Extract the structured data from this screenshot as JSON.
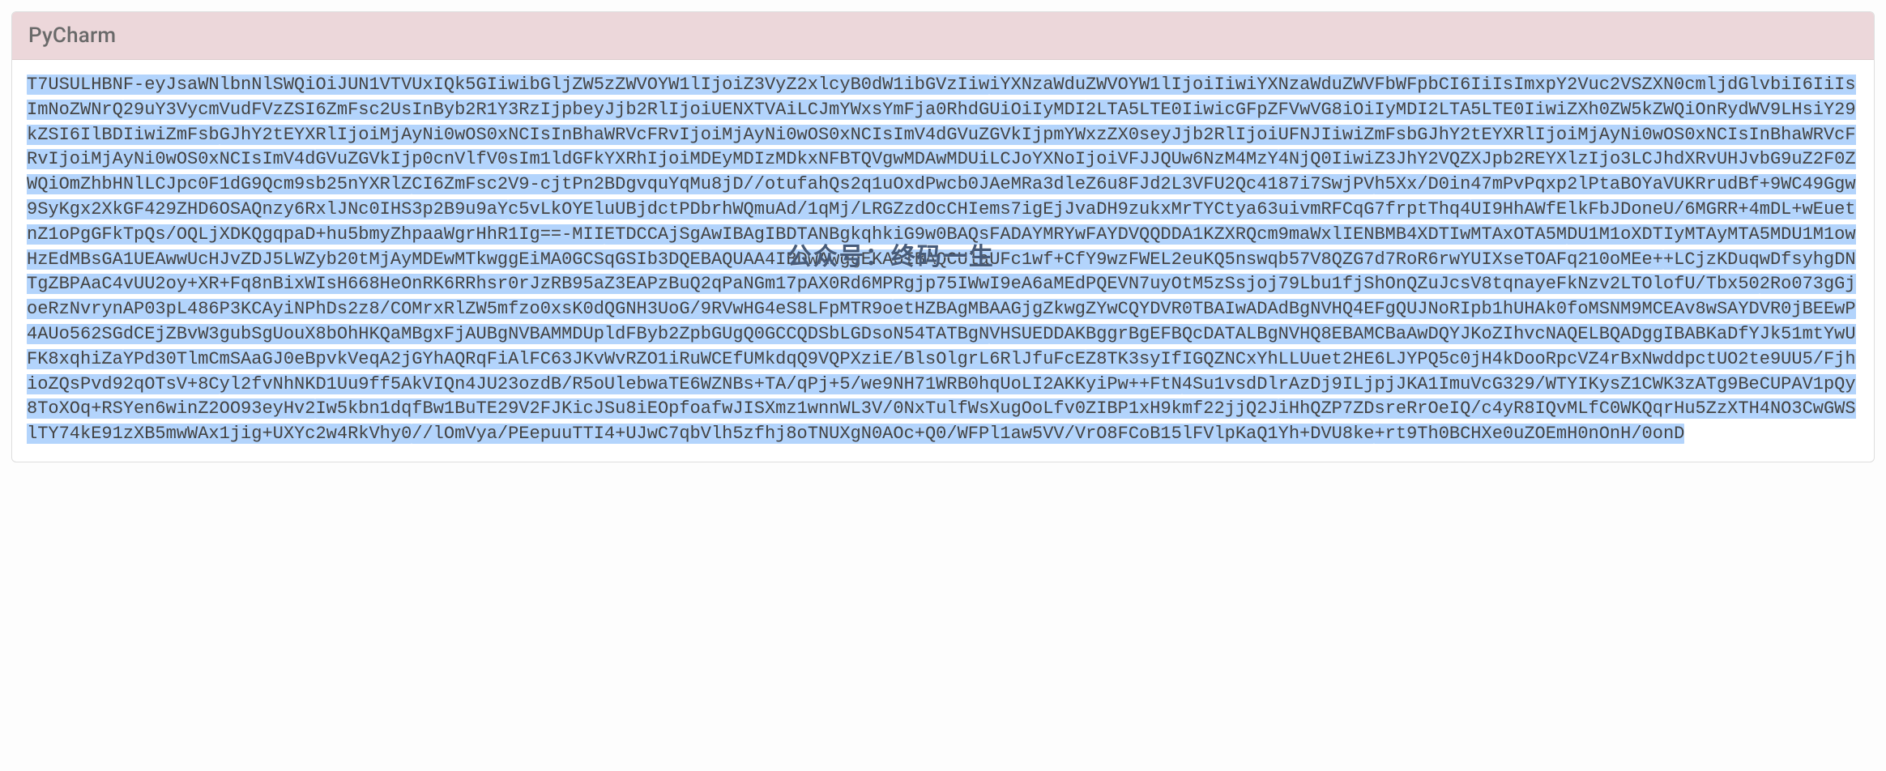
{
  "header": {
    "title": "PyCharm"
  },
  "license": {
    "code": "T7USULHBNF-eyJsaWNlbnNlSWQiOiJUN1VTVUxIQk5GIiwibGljZW5zZWVOYW1lIjoiZ3VyZ2xlcyB0dW1ibGVzIiwiYXNzaWduZWVOYW1lIjoiIiwiYXNzaWduZWVFbWFpbCI6IiIsImxpY2Vuc2VSZXN0cmljdGlvbiI6IiIsImNoZWNrQ29uY3VycmVudFVzZSI6ZmFsc2UsInByb2R1Y3RzIjpbeyJjb2RlIjoiUENXTVAiLCJmYWxsYmFja0RhdGUiOiIyMDI2LTA5LTE0IiwicGFpZFVwVG8iOiIyMDI2LTA5LTE0IiwiZXh0ZW5kZWQiOnRydWV9LHsiY29kZSI6IlBDIiwiZmFsbGJhY2tEYXRlIjoiMjAyNi0wOS0xNCIsInBhaWRVcFRvIjoiMjAyNi0wOS0xNCIsImV4dGVuZGVkIjpmYWxzZX0seyJjb2RlIjoiUFNJIiwiZmFsbGJhY2tEYXRlIjoiMjAyNi0wOS0xNCIsInBhaWRVcFRvIjoiMjAyNi0wOS0xNCIsImV4dGVuZGVkIjp0cnVlfV0sIm1ldGFkYXRhIjoiMDEyMDIzMDkxNFBTQVgwMDAwMDUiLCJoYXNoIjoiVFJJQUw6NzM4MzY4NjQ0IiwiZ3JhY2VQZXJpb2REYXlzIjo3LCJhdXRvUHJvbG9uZ2F0ZWQiOmZhbHNlLCJpc0F1dG9Qcm9sb25nYXRlZCI6ZmFsc2V9-cjtPn2BDgvquYqMu8jD//otufahQs2q1uOxdPwcb0JAeMRa3dleZ6u8FJd2L3VFU2Qc4187i7SwjPVh5Xx/D0in47mPvPqxp2lPtaBOYaVUKRrudBf+9WC49Ggw9SyKgx2XkGF429ZHD6OSAQnzy6RxlJNc0IHS3p2B9u9aYc5vLkOYEluUBjdctPDbrhWQmuAd/1qMj/LRGZzdOcCHIems7igEjJvaDH9zukxMrTYCtya63uivmRFCqG7frptThq4UI9HhAWfElkFbJDoneU/6MGRR+4mDL+wEuetnZ1oPgGFkTpQs/OQLjXDKQgqpaD+hu5bmyZhpaaWgrHhR1Ig==-MIIETDCCAjSgAwIBAgIBDTANBgkqhkiG9w0BAQsFADAYMRYwFAYDVQQDDA1KZXRQcm9maWxlIENBMB4XDTIwMTAxOTA5MDU1M1oXDTIyMTAyMTA5MDU1M1owHzEdMBsGA1UEAwwUcHJvZDJ5LWZyb20tMjAyMDEwMTkwggEiMA0GCSqGSIb3DQEBAQUAA4IBDwAwggEKAoIBAQCUlaUFc1wf+CfY9wzFWEL2euKQ5nswqb57V8QZG7d7RoR6rwYUIXseTOAFq210oMEe++LCjzKDuqwDfsyhgDNTgZBPAaC4vUU2oy+XR+Fq8nBixWIsH668HeOnRK6RRhsr0rJzRB95aZ3EAPzBuQ2qPaNGm17pAX0Rd6MPRgjp75IWwI9eA6aMEdPQEVN7uyOtM5zSsjoj79Lbu1fjShOnQZuJcsV8tqnayeFkNzv2LTOlofU/Tbx502Ro073gGjoeRzNvrynAP03pL486P3KCAyiNPhDs2z8/COMrxRlZW5mfzo0xsK0dQGNH3UoG/9RVwHG4eS8LFpMTR9oetHZBAgMBAAGjgZkwgZYwCQYDVR0TBAIwADAdBgNVHQ4EFgQUJNoRIpb1hUHAk0foMSNM9MCEAv8wSAYDVR0jBEEwP4AUo562SGdCEjZBvW3gubSgUouX8bOhHKQaMBgxFjAUBgNVBAMMDUpldFByb2ZpbGUgQ0GCCQDSbLGDsoN54TATBgNVHSUEDDAKBggrBgEFBQcDATALBgNVHQ8EBAMCBaAwDQYJKoZIhvcNAQELBQADggIBABKaDfYJk51mtYwUFK8xqhiZaYPd30TlmCmSAaGJ0eBpvkVeqA2jGYhAQRqFiAlFC63JKvWvRZO1iRuWCEfUMkdqQ9VQPXziE/BlsOlgrL6RlJfuFcEZ8TK3syIfIGQZNCxYhLLUuet2HE6LJYPQ5c0jH4kDooRpcVZ4rBxNwddpctUO2te9UU5/FjhioZQsPvd92qOTsV+8Cyl2fvNhNKD1Uu9ff5AkVIQn4JU23ozdB/R5oUlebwaTE6WZNBs+TA/qPj+5/we9NH71WRB0hqUoLI2AKKyiPw++FtN4Su1vsdDlrAzDj9ILjpjJKA1ImuVcG329/WTYIKysZ1CWK3zATg9BeCUPAV1pQy8ToXOq+RSYen6winZ2OO93eyHv2Iw5kbn1dqfBw1BuTE29V2FJKicJSu8iEOpfoafwJISXmz1wnnWL3V/0NxTulfWsXugOoLfv0ZIBP1xH9kmf22jjQ2JiHhQZP7ZDsreRrOeIQ/c4yR8IQvMLfC0WKQqrHu5ZzXTH4NO3CwGWSlTY74kE91zXB5mwWAx1jig+UXYc2w4RkVhy0//lOmVya/PEepuuTTI4+UJwC7qbVlh5zfhj8oTNUXgN0AOc+Q0/WFPl1aw5VV/VrO8FCoB15lFVlpKaQ1Yh+DVU8ke+rt9Th0BCHXe0uZOEmH0nOnH/0onD"
  },
  "watermark": {
    "text": "公众号：终码一生"
  }
}
